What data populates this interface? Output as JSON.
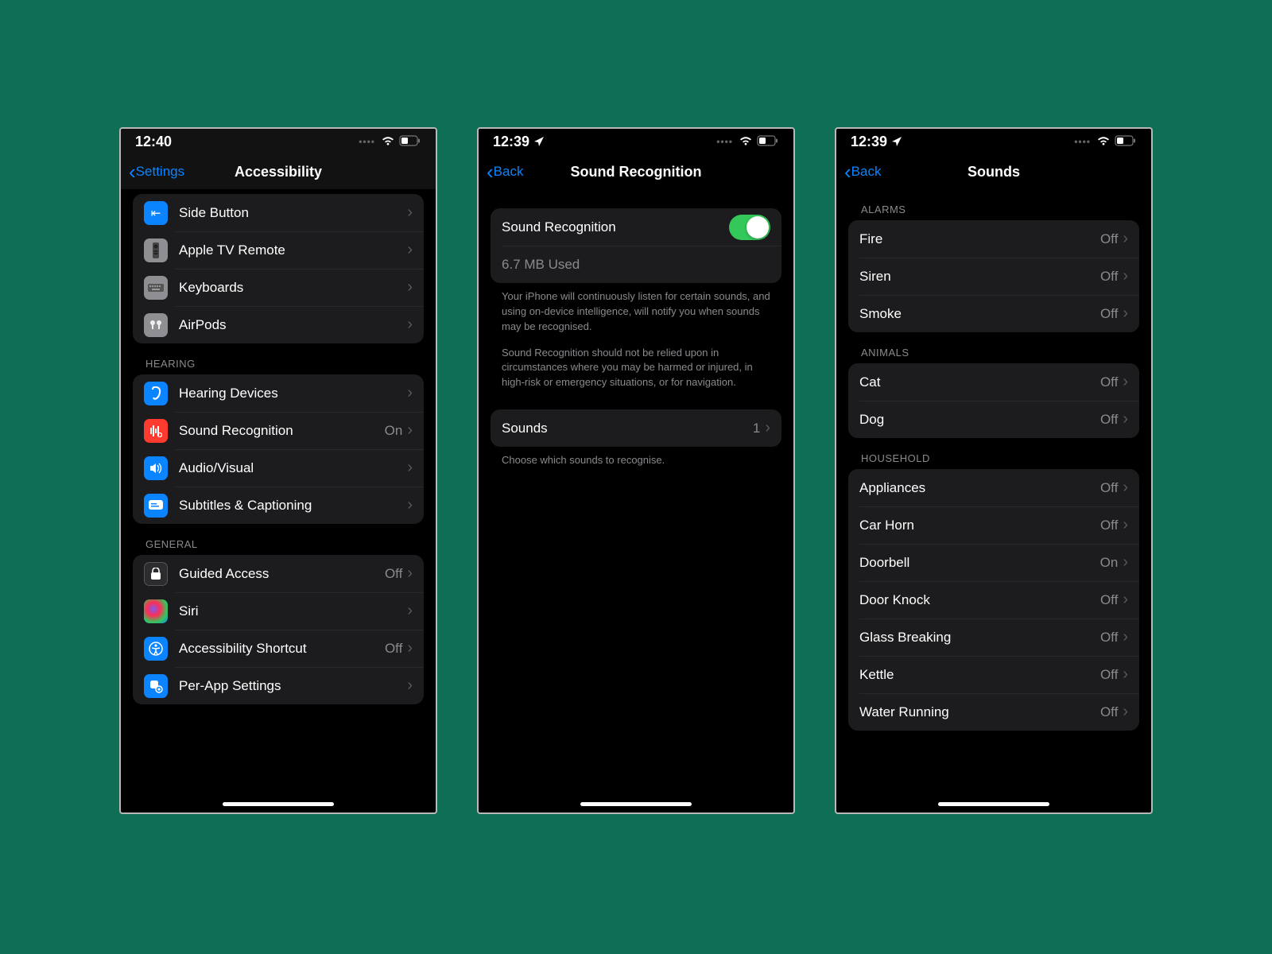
{
  "screen1": {
    "time": "12:40",
    "back": "Settings",
    "title": "Accessibility",
    "group1": [
      {
        "label": "Side Button",
        "value": ""
      },
      {
        "label": "Apple TV Remote",
        "value": ""
      },
      {
        "label": "Keyboards",
        "value": ""
      },
      {
        "label": "AirPods",
        "value": ""
      }
    ],
    "hearing_header": "HEARING",
    "hearing": [
      {
        "label": "Hearing Devices",
        "value": ""
      },
      {
        "label": "Sound Recognition",
        "value": "On"
      },
      {
        "label": "Audio/Visual",
        "value": ""
      },
      {
        "label": "Subtitles & Captioning",
        "value": ""
      }
    ],
    "general_header": "GENERAL",
    "general": [
      {
        "label": "Guided Access",
        "value": "Off"
      },
      {
        "label": "Siri",
        "value": ""
      },
      {
        "label": "Accessibility Shortcut",
        "value": "Off"
      },
      {
        "label": "Per-App Settings",
        "value": ""
      }
    ]
  },
  "screen2": {
    "time": "12:39",
    "back": "Back",
    "title": "Sound Recognition",
    "toggle_label": "Sound Recognition",
    "storage": "6.7 MB Used",
    "desc1": "Your iPhone will continuously listen for certain sounds, and using on-device intelligence, will notify you when sounds may be recognised.",
    "desc2": "Sound Recognition should not be relied upon in circumstances where you may be harmed or injured, in high-risk or emergency situations, or for navigation.",
    "sounds_label": "Sounds",
    "sounds_value": "1",
    "choose": "Choose which sounds to recognise."
  },
  "screen3": {
    "time": "12:39",
    "back": "Back",
    "title": "Sounds",
    "alarms_header": "ALARMS",
    "alarms": [
      {
        "label": "Fire",
        "value": "Off"
      },
      {
        "label": "Siren",
        "value": "Off"
      },
      {
        "label": "Smoke",
        "value": "Off"
      }
    ],
    "animals_header": "ANIMALS",
    "animals": [
      {
        "label": "Cat",
        "value": "Off"
      },
      {
        "label": "Dog",
        "value": "Off"
      }
    ],
    "household_header": "HOUSEHOLD",
    "household": [
      {
        "label": "Appliances",
        "value": "Off"
      },
      {
        "label": "Car Horn",
        "value": "Off"
      },
      {
        "label": "Doorbell",
        "value": "On"
      },
      {
        "label": "Door Knock",
        "value": "Off"
      },
      {
        "label": "Glass Breaking",
        "value": "Off"
      },
      {
        "label": "Kettle",
        "value": "Off"
      },
      {
        "label": "Water Running",
        "value": "Off"
      }
    ]
  }
}
